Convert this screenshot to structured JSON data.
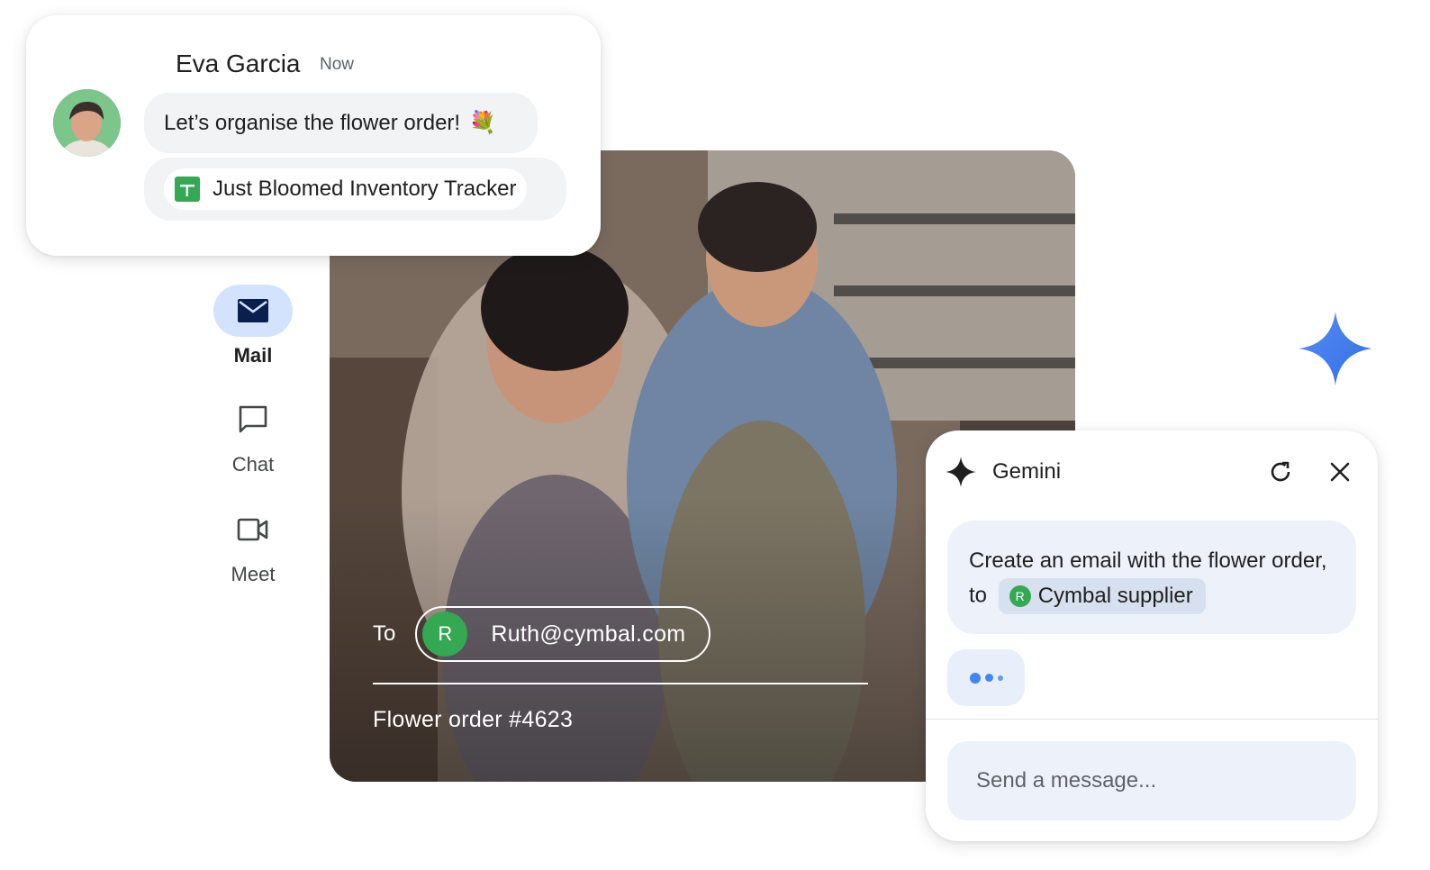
{
  "chat": {
    "sender_name": "Eva Garcia",
    "timestamp": "Now",
    "message": "Let’s organise the flower order!",
    "message_emoji": "💐",
    "attachment_title": "Just Bloomed Inventory Tracker",
    "attachment_icon": "sheets-icon"
  },
  "rail": {
    "items": [
      {
        "label": "Mail",
        "icon": "mail-icon",
        "active": true
      },
      {
        "label": "Chat",
        "icon": "chat-icon",
        "active": false
      },
      {
        "label": "Meet",
        "icon": "video-camera-icon",
        "active": false
      }
    ]
  },
  "email": {
    "to_label": "To",
    "recipient_initial": "R",
    "recipient_email": "Ruth@cymbal.com",
    "subject": "Flower order #4623"
  },
  "gemini": {
    "title": "Gemini",
    "prompt_text": "Create an email with the flower order, to",
    "mention_initial": "R",
    "mention_label": "Cymbal supplier",
    "input_placeholder": "Send a message...",
    "refresh_icon": "refresh-icon",
    "close_icon": "close-icon"
  },
  "colors": {
    "accent_blue": "#4285f4",
    "active_pill": "#d3e3fd",
    "avatar_green": "#34a853",
    "panel_tint": "#edf2fa"
  }
}
